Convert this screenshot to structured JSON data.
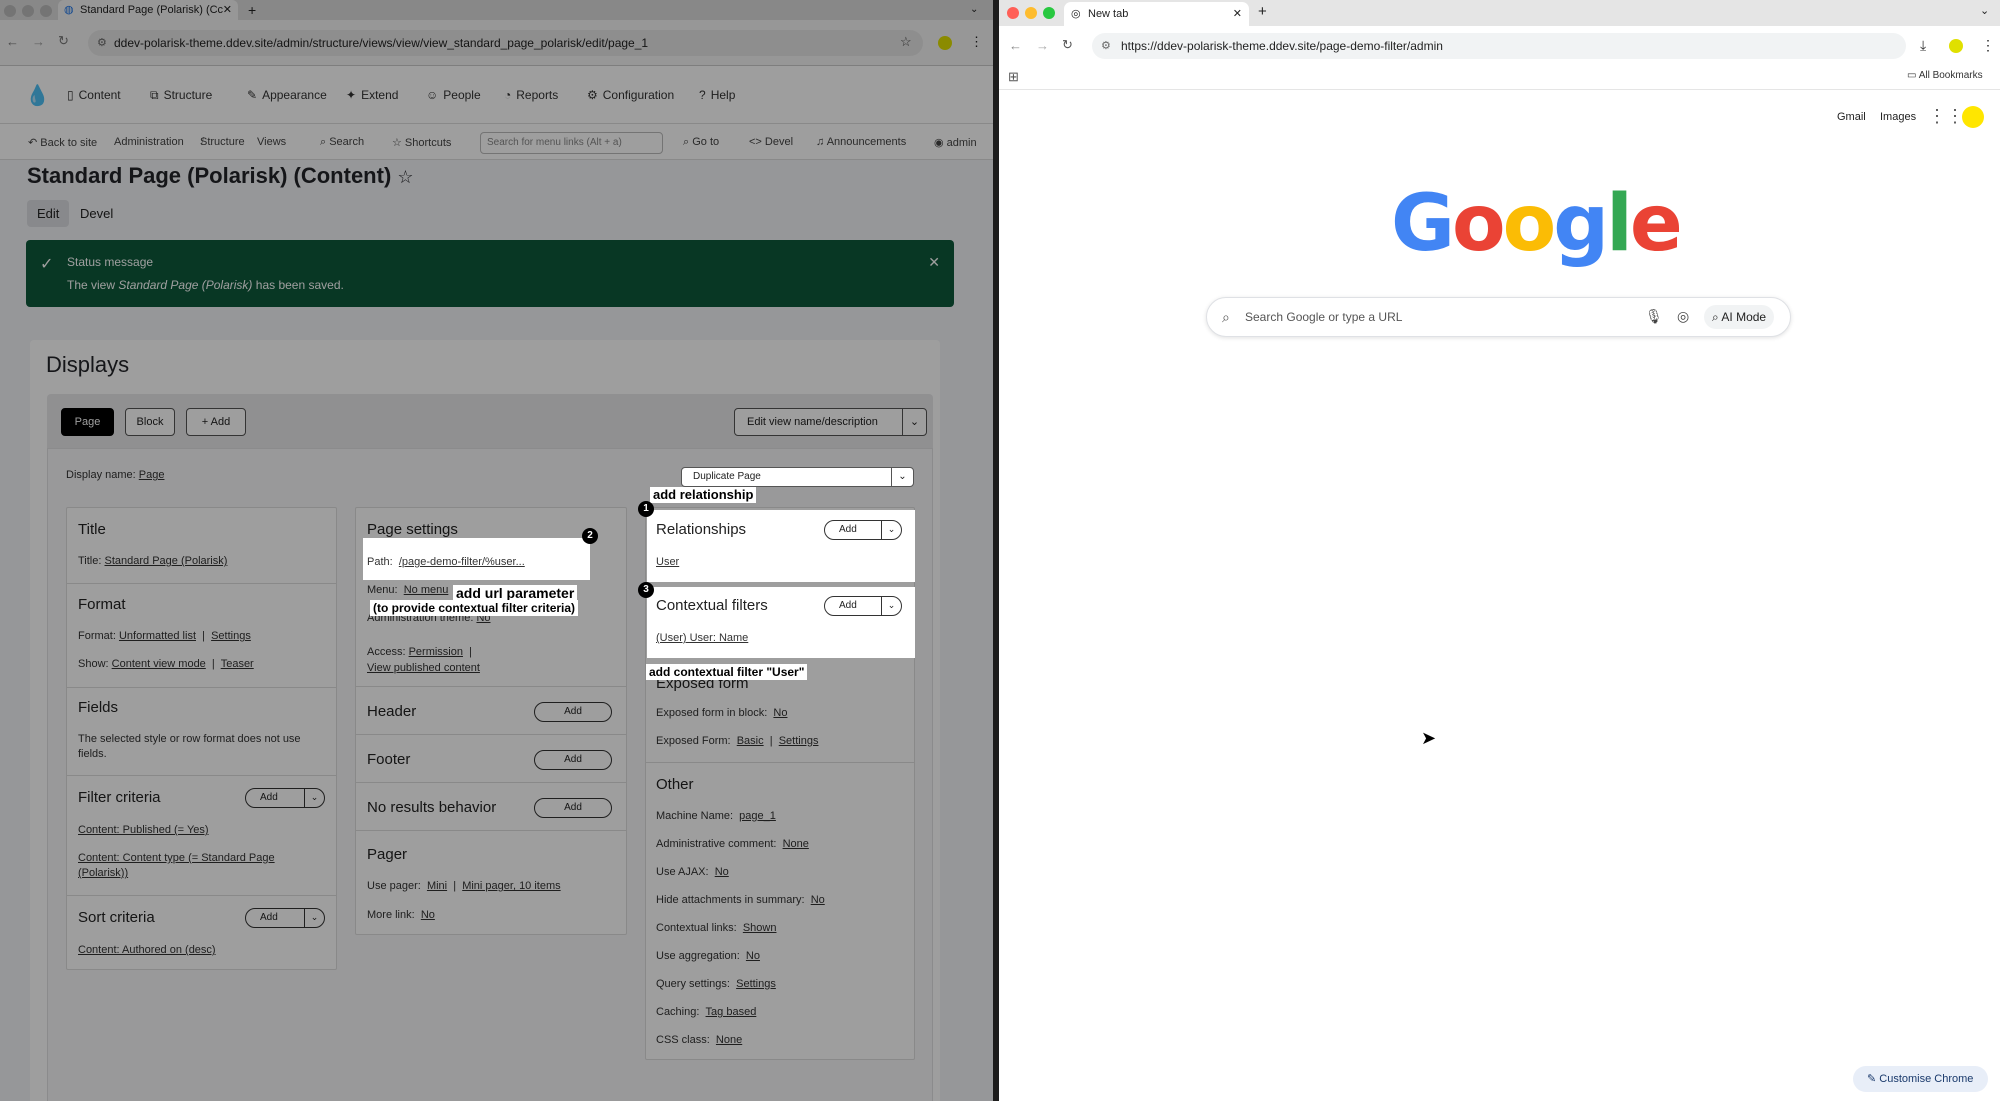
{
  "left_window": {
    "tab": {
      "title": "Standard Page (Polarisk) (Cc"
    },
    "url": "ddev-polarisk-theme.ddev.site/admin/structure/views/view/view_standard_page_polarisk/edit/page_1",
    "toolbar": [
      "Content",
      "Structure",
      "Appearance",
      "Extend",
      "People",
      "Reports",
      "Configuration",
      "Help"
    ],
    "secondary": {
      "back": "Back to site",
      "breadcrumbs": [
        "Administration",
        "Structure",
        "Views"
      ],
      "search": "Search",
      "shortcuts": "Shortcuts",
      "search_placeholder": "Search for menu links (Alt + a)",
      "goto": "Go to",
      "devel": "Devel",
      "announcements": "Announcements",
      "user": "admin"
    },
    "page_title": "Standard Page (Polarisk) (Content)",
    "local_tabs": [
      "Edit",
      "Devel"
    ],
    "status": {
      "heading": "Status message",
      "text_prefix": "The view ",
      "text_em": "Standard Page (Polarisk)",
      "text_suffix": " has been saved."
    },
    "displays": {
      "heading": "Displays",
      "tabs": [
        "Page",
        "Block",
        "+ Add"
      ],
      "edit_name": "Edit view name/description",
      "display_name_label": "Display name:",
      "display_name_value": "Page",
      "duplicate": "Duplicate Page"
    },
    "col1": {
      "title_h": "Title",
      "title_label": "Title:",
      "title_value": "Standard Page (Polarisk)",
      "format_h": "Format",
      "format_label": "Format:",
      "format_value": "Unformatted list",
      "format_settings": "Settings",
      "show_label": "Show:",
      "show_value": "Content view mode",
      "show_teaser": "Teaser",
      "fields_h": "Fields",
      "fields_text": "The selected style or row format does not use fields.",
      "filter_h": "Filter criteria",
      "filter_items": [
        "Content: Published (= Yes)",
        "Content: Content type (= Standard Page (Polarisk))"
      ],
      "sort_h": "Sort criteria",
      "sort_items": [
        "Content: Authored on (desc)"
      ],
      "add": "Add"
    },
    "col2": {
      "page_settings_h": "Page settings",
      "path_label": "Path:",
      "path_value": "/page-demo-filter/%user...",
      "menu_label": "Menu:",
      "menu_value": "No menu",
      "admin_theme_label": "Administration theme:",
      "admin_theme_value": "No",
      "access_label": "Access:",
      "access_value": "Permission",
      "access_view": "View published content",
      "header_h": "Header",
      "footer_h": "Footer",
      "no_results_h": "No results behavior",
      "pager_h": "Pager",
      "use_pager_label": "Use pager:",
      "use_pager_value": "Mini",
      "use_pager_items": "Mini pager, 10 items",
      "more_link_label": "More link:",
      "more_link_value": "No",
      "add": "Add"
    },
    "col3": {
      "relationships_h": "Relationships",
      "relationships_items": [
        "User"
      ],
      "contextual_h": "Contextual filters",
      "contextual_items": [
        "(User) User: Name"
      ],
      "exposed_h": "Exposed form",
      "exposed_block_label": "Exposed form in block:",
      "exposed_block_value": "No",
      "exposed_form_label": "Exposed Form:",
      "exposed_form_value": "Basic",
      "exposed_form_settings": "Settings",
      "other_h": "Other",
      "other_rows": [
        {
          "label": "Machine Name:",
          "value": "page_1"
        },
        {
          "label": "Administrative comment:",
          "value": "None"
        },
        {
          "label": "Use AJAX:",
          "value": "No"
        },
        {
          "label": "Hide attachments in summary:",
          "value": "No"
        },
        {
          "label": "Contextual links:",
          "value": "Shown"
        },
        {
          "label": "Use aggregation:",
          "value": "No"
        },
        {
          "label": "Query settings:",
          "value": "Settings"
        },
        {
          "label": "Caching:",
          "value": "Tag based"
        },
        {
          "label": "CSS class:",
          "value": "None"
        }
      ],
      "add": "Add"
    },
    "annotations": {
      "relationship": "add relationship",
      "url_param": "add url parameter",
      "url_param_sub": "(to provide contextual filter criteria)",
      "contextual": "add contextual filter \"User\"",
      "n1": "1",
      "n2": "2",
      "n3": "3"
    }
  },
  "right_window": {
    "tab": {
      "title": "New tab"
    },
    "url": "https://ddev-polarisk-theme.ddev.site/page-demo-filter/admin",
    "all_bookmarks": "All Bookmarks",
    "links": [
      "Gmail",
      "Images"
    ],
    "search_placeholder": "Search Google or type a URL",
    "ai_mode": "AI Mode",
    "customise": "Customise Chrome"
  },
  "colors": {
    "google_blue": "#4285F4",
    "google_red": "#EA4335",
    "google_yellow": "#FBBC05",
    "google_green": "#34A853",
    "status_bg": "#0d5a3b"
  }
}
